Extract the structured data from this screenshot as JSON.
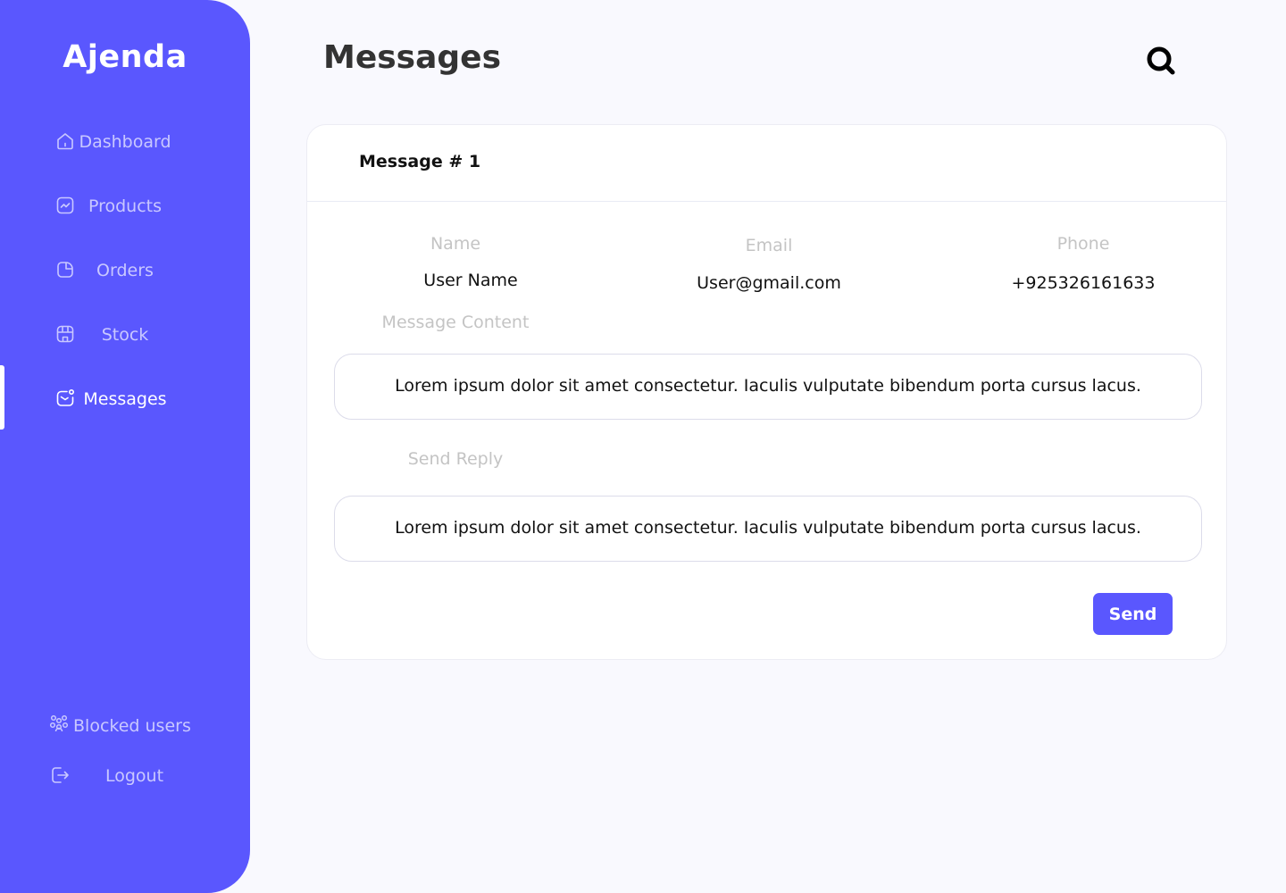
{
  "brand": {
    "name": "Ajenda"
  },
  "colors": {
    "accent": "#5a57fe",
    "sidebar_inactive_text": "#c9c8ff",
    "label_muted": "#c4c4c4"
  },
  "sidebar": {
    "items": [
      {
        "label": "Dashboard",
        "icon": "home-icon"
      },
      {
        "label": "Products",
        "icon": "chart-icon"
      },
      {
        "label": "Orders",
        "icon": "pie-icon"
      },
      {
        "label": "Stock",
        "icon": "store-icon"
      },
      {
        "label": "Messages",
        "icon": "mail-icon",
        "active": true
      }
    ],
    "bottom": [
      {
        "label": "Blocked users",
        "icon": "users-icon"
      },
      {
        "label": "Logout",
        "icon": "logout-icon"
      }
    ]
  },
  "header": {
    "title": "Messages",
    "search_icon": "search-icon"
  },
  "message": {
    "title": "Message # 1",
    "name_label": "Name",
    "name_value": "User Name",
    "email_label": "Email",
    "email_value": "User@gmail.com",
    "phone_label": "Phone",
    "phone_value": "+925326161633",
    "content_label": "Message Content",
    "content_text": "Lorem ipsum dolor sit amet consectetur. Iaculis vulputate bibendum porta cursus lacus.",
    "reply_label": "Send Reply",
    "reply_text": "Lorem ipsum dolor sit amet consectetur. Iaculis vulputate bibendum porta cursus lacus.",
    "send_label": "Send"
  }
}
